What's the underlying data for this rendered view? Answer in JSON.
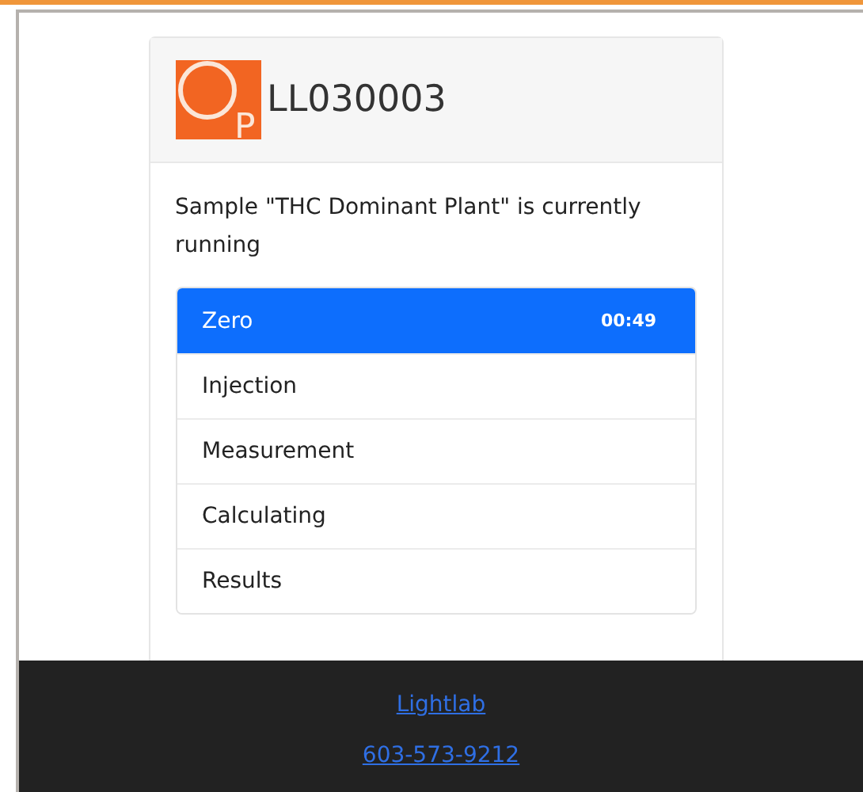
{
  "header": {
    "logo_letter": "P",
    "device": "LL030003"
  },
  "message": "Sample \"THC Dominant Plant\" is currently running",
  "steps": [
    {
      "label": "Zero",
      "selected": true,
      "time": "00:49"
    },
    {
      "label": "Injection",
      "selected": false
    },
    {
      "label": "Measurement",
      "selected": false
    },
    {
      "label": "Calculating",
      "selected": false
    },
    {
      "label": "Results",
      "selected": false
    }
  ],
  "footer": {
    "links": [
      "Lightlab",
      "603-573-9212"
    ]
  }
}
